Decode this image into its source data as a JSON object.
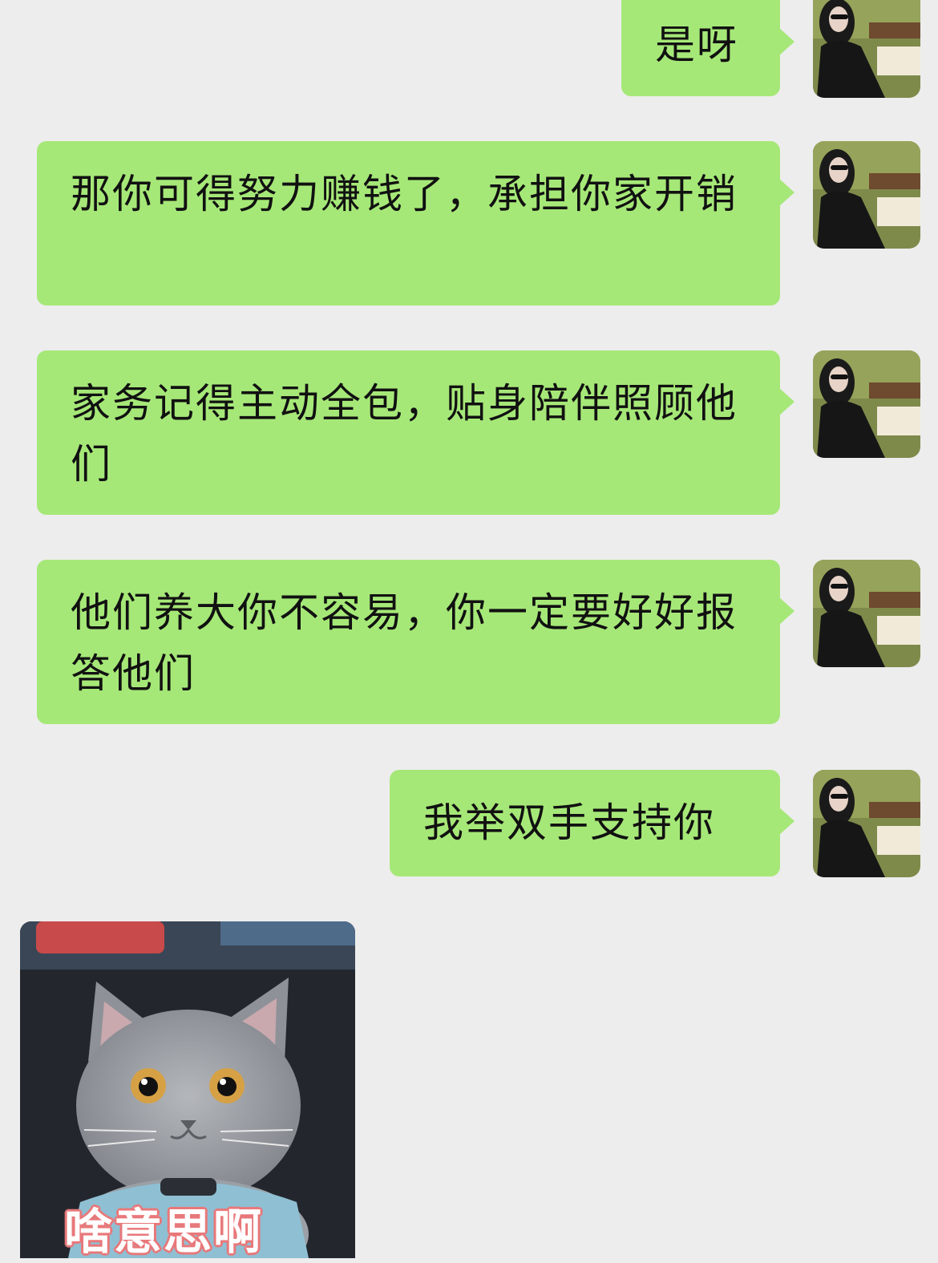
{
  "chat": {
    "messages": [
      {
        "sender": "self",
        "text": "是呀"
      },
      {
        "sender": "self",
        "text": "那你可得努力赚钱了，承担你家开销"
      },
      {
        "sender": "self",
        "text": "家务记得主动全包，贴身陪伴照顾他们"
      },
      {
        "sender": "self",
        "text": "他们养大你不容易，你一定要好好报答他们"
      },
      {
        "sender": "self",
        "text": "我举双手支持你"
      }
    ],
    "sticker": {
      "caption": "啥意思啊",
      "icon": "cat-sticker-image"
    },
    "avatar_icon": "user-avatar-photo"
  },
  "colors": {
    "background": "#ededed",
    "self_bubble": "#a6e878",
    "sticker_caption_outline": "#e8787a"
  }
}
